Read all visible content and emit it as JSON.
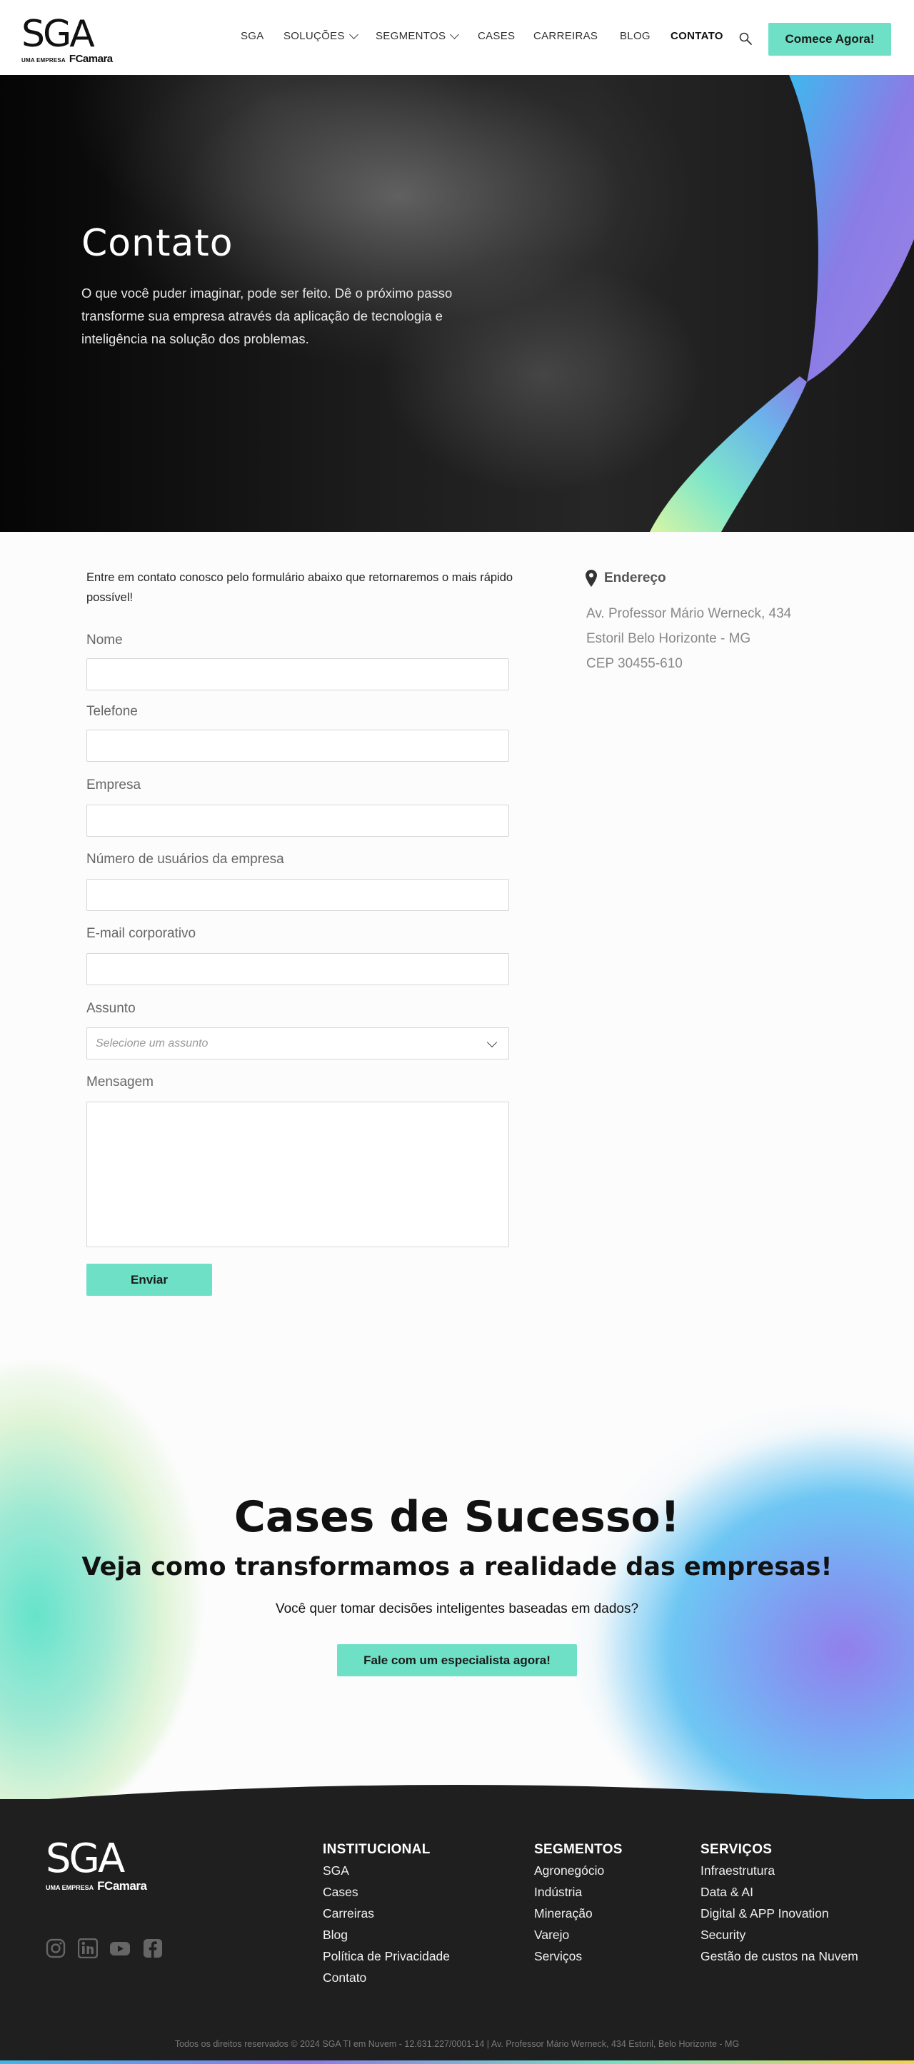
{
  "header": {
    "logo_main": "SGA",
    "logo_prefix": "UMA EMPRESA",
    "logo_brand": "FCamara",
    "nav": [
      {
        "label": "SGA",
        "has_dropdown": false
      },
      {
        "label": "SOLUÇÕES",
        "has_dropdown": true
      },
      {
        "label": "SEGMENTOS",
        "has_dropdown": true
      },
      {
        "label": "CASES",
        "has_dropdown": false
      },
      {
        "label": "CARREIRAS",
        "has_dropdown": false
      },
      {
        "label": "BLOG",
        "has_dropdown": false
      },
      {
        "label": "CONTATO",
        "has_dropdown": false,
        "active": true
      }
    ],
    "search_icon": "search-icon",
    "cta_label": "Comece Agora!"
  },
  "hero": {
    "title": "Contato",
    "subtitle": "O que você puder imaginar, pode ser feito. Dê o próximo passo transforme sua empresa através da aplicação de tecnologia e inteligência na solução dos problemas."
  },
  "form": {
    "intro": "Entre em contato conosco pelo formulário abaixo que retornaremos o mais rápido possível!",
    "fields": {
      "nome": {
        "label": "Nome",
        "value": ""
      },
      "telefone": {
        "label": "Telefone",
        "value": ""
      },
      "empresa": {
        "label": "Empresa",
        "value": ""
      },
      "usuarios": {
        "label": "Número de usuários da empresa",
        "value": ""
      },
      "email": {
        "label": "E-mail corporativo",
        "value": ""
      },
      "assunto": {
        "label": "Assunto",
        "placeholder": "Selecione um assunto"
      },
      "mensagem": {
        "label": "Mensagem",
        "value": ""
      }
    },
    "submit_label": "Enviar"
  },
  "address": {
    "icon": "map-pin-icon",
    "title": "Endereço",
    "lines": [
      "Av. Professor Mário Werneck, 434",
      "Estoril Belo Horizonte - MG",
      "CEP 30455-610"
    ]
  },
  "cases": {
    "title": "Cases de Sucesso!",
    "subtitle": "Veja como transformamos a realidade das empresas!",
    "question": "Você quer tomar decisões inteligentes baseadas em dados?",
    "cta_label": "Fale com um especialista agora!"
  },
  "footer": {
    "logo_main": "SGA",
    "logo_prefix": "UMA EMPRESA",
    "logo_brand": "FCamara",
    "social": [
      "instagram-icon",
      "linkedin-icon",
      "youtube-icon",
      "facebook-icon"
    ],
    "columns": [
      {
        "title": "INSTITUCIONAL",
        "links": [
          "SGA",
          "Cases",
          "Carreiras",
          "Blog",
          "Política de Privacidade",
          "Contato"
        ]
      },
      {
        "title": "SEGMENTOS",
        "links": [
          "Agronegócio",
          "Indústria",
          "Mineração",
          "Varejo",
          "Serviços"
        ]
      },
      {
        "title": "SERVIÇOS",
        "links": [
          "Infraestrutura",
          "Data & AI",
          "Digital & APP Inovation",
          "Security",
          "Gestão de custos na Nuvem"
        ]
      }
    ],
    "copyright": "Todos os direitos reservados © 2024 SGA TI em Nuvem - 12.631.227/0001-14 | Av. Professor Mário Werneck, 434 Estoril, Belo Horizonte - MG"
  },
  "colors": {
    "accent": "#6ee0c6",
    "footer_bg": "#1f1f1f",
    "hero_bg": "#0d0d0d"
  }
}
